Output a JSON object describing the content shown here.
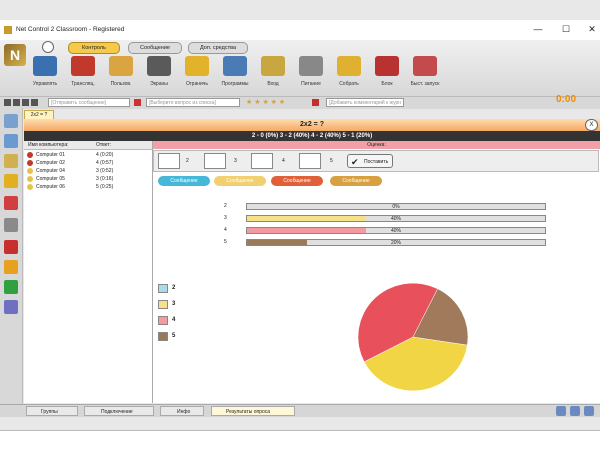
{
  "window": {
    "title": "Net Control 2 Classroom - Registered",
    "min": "—",
    "max": "☐",
    "close": "✕"
  },
  "ribbon": {
    "tabs": [
      "Контроль",
      "Сообщение",
      "Доп. средства"
    ],
    "tools": [
      {
        "label": "Управлять",
        "color": "#3a6fb0"
      },
      {
        "label": "Трансляц.",
        "color": "#c0392b"
      },
      {
        "label": "Пользов.",
        "color": "#d9a441"
      },
      {
        "label": "Экраны",
        "color": "#5a5a5a"
      },
      {
        "label": "Ограничь",
        "color": "#e1b22a"
      },
      {
        "label": "Программы",
        "color": "#4b7bb5"
      },
      {
        "label": "Вход",
        "color": "#c8a640"
      },
      {
        "label": "Питание",
        "color": "#888888"
      },
      {
        "label": "Собрать",
        "color": "#e0b030"
      },
      {
        "label": "Блок",
        "color": "#b83232"
      },
      {
        "label": "Быст. запуск",
        "color": "#c34b4b"
      }
    ]
  },
  "timer": "0:00",
  "toolbar2": {
    "msg_placeholder": "[Отправить сообщение]",
    "question_placeholder": "[Выберите вопрос из списка]",
    "comment_placeholder": "[Добавить комментарий к журн"
  },
  "question_tab": "2x2 = ?",
  "question_title": "2x2 = ?",
  "summary": "2 - 0 (0%)    3 - 2 (40%)    4 - 2 (40%)    5 - 1 (20%)",
  "left_panel": {
    "col_computer": "Имя компьютера:",
    "col_answer": "Ответ:",
    "rows": [
      {
        "name": "Computer 01",
        "answer": "4 (0:20)",
        "color": "#c0392b"
      },
      {
        "name": "Computer 02",
        "answer": "4 (0:57)",
        "color": "#c0392b"
      },
      {
        "name": "Computer 04",
        "answer": "3 (0:52)",
        "color": "#e8c34a"
      },
      {
        "name": "Computer 05",
        "answer": "3 (0:16)",
        "color": "#e8c34a"
      },
      {
        "name": "Computer 06",
        "answer": "5 (0:25)",
        "color": "#e8c34a"
      }
    ]
  },
  "rating": {
    "header": "Оценка:",
    "scores": [
      "2",
      "3",
      "4",
      "5"
    ],
    "put_label": "Поставить",
    "pills": [
      {
        "label": "Сообщение",
        "color": "#45b8d8"
      },
      {
        "label": "Сообщение",
        "color": "#f0d070"
      },
      {
        "label": "Сообщение",
        "color": "#e0603a"
      },
      {
        "label": "Сообщение",
        "color": "#d7a040"
      }
    ]
  },
  "chart_data": {
    "type": "bar",
    "categories": [
      "2",
      "3",
      "4",
      "5"
    ],
    "values": [
      0,
      40,
      40,
      20
    ],
    "value_labels": [
      "0%",
      "40%",
      "40%",
      "20%"
    ],
    "colors": [
      "#a9dbe8",
      "#f7e08a",
      "#f59aa0",
      "#9b7a5a"
    ],
    "pie": [
      {
        "label": "3",
        "value": 40,
        "color": "#f2d544"
      },
      {
        "label": "4",
        "value": 40,
        "color": "#e8505b"
      },
      {
        "label": "5",
        "value": 20,
        "color": "#a07a5a"
      }
    ]
  },
  "bottom_tabs": [
    "Группы",
    "Подключение",
    "Инфо",
    "Результаты опроса"
  ]
}
